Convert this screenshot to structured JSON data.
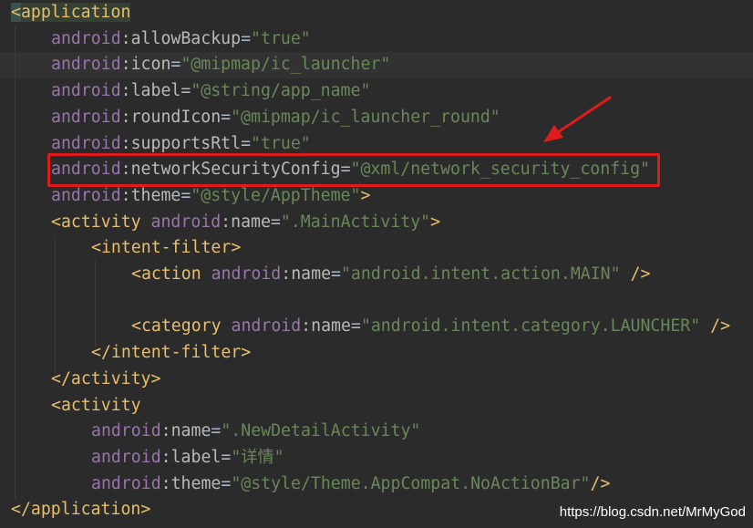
{
  "lines": [
    {
      "segs": [
        [
          "br",
          "<"
        ],
        [
          "tag",
          "application"
        ]
      ]
    },
    {
      "segs": [
        [
          "ns",
          "android"
        ],
        [
          "at",
          ":allowBackup"
        ],
        [
          "pn",
          "="
        ],
        [
          "st",
          "\"true\""
        ]
      ]
    },
    {
      "segs": [
        [
          "ns",
          "android"
        ],
        [
          "at",
          ":icon"
        ],
        [
          "pn",
          "="
        ],
        [
          "st",
          "\"@mipmap/ic_launcher\""
        ]
      ]
    },
    {
      "segs": [
        [
          "ns",
          "android"
        ],
        [
          "at",
          ":label"
        ],
        [
          "pn",
          "="
        ],
        [
          "st",
          "\"@string/app_name\""
        ]
      ]
    },
    {
      "segs": [
        [
          "ns",
          "android"
        ],
        [
          "at",
          ":roundIcon"
        ],
        [
          "pn",
          "="
        ],
        [
          "st",
          "\"@mipmap/ic_launcher_round\""
        ]
      ]
    },
    {
      "segs": [
        [
          "ns",
          "android"
        ],
        [
          "at",
          ":supportsRtl"
        ],
        [
          "pn",
          "="
        ],
        [
          "st",
          "\"true\""
        ]
      ]
    },
    {
      "segs": [
        [
          "ns",
          "android"
        ],
        [
          "at",
          ":networkSecurityConfig"
        ],
        [
          "pn",
          "="
        ],
        [
          "st",
          "\"@xml/network_security_config\""
        ]
      ]
    },
    {
      "segs": [
        [
          "ns",
          "android"
        ],
        [
          "at",
          ":theme"
        ],
        [
          "pn",
          "="
        ],
        [
          "st",
          "\"@style/AppTheme\""
        ],
        [
          "br",
          ">"
        ]
      ]
    },
    {
      "segs": [
        [
          "br",
          "<"
        ],
        [
          "tag",
          "activity "
        ],
        [
          "ns",
          "android"
        ],
        [
          "at",
          ":name"
        ],
        [
          "pn",
          "="
        ],
        [
          "st",
          "\".MainActivity\""
        ],
        [
          "br",
          ">"
        ]
      ]
    },
    {
      "segs": [
        [
          "br",
          "<"
        ],
        [
          "tag",
          "intent-filter"
        ],
        [
          "br",
          ">"
        ]
      ]
    },
    {
      "segs": [
        [
          "br",
          "<"
        ],
        [
          "tag",
          "action "
        ],
        [
          "ns",
          "android"
        ],
        [
          "at",
          ":name"
        ],
        [
          "pn",
          "="
        ],
        [
          "st",
          "\"android.intent.action.MAIN\""
        ],
        [
          "br",
          " />"
        ]
      ]
    },
    {
      "segs": []
    },
    {
      "segs": [
        [
          "br",
          "<"
        ],
        [
          "tag",
          "category "
        ],
        [
          "ns",
          "android"
        ],
        [
          "at",
          ":name"
        ],
        [
          "pn",
          "="
        ],
        [
          "st",
          "\"android.intent.category.LAUNCHER\""
        ],
        [
          "br",
          " />"
        ]
      ]
    },
    {
      "segs": [
        [
          "br",
          "</"
        ],
        [
          "tag",
          "intent-filter"
        ],
        [
          "br",
          ">"
        ]
      ]
    },
    {
      "segs": [
        [
          "br",
          "</"
        ],
        [
          "tag",
          "activity"
        ],
        [
          "br",
          ">"
        ]
      ]
    },
    {
      "segs": [
        [
          "br",
          "<"
        ],
        [
          "tag",
          "activity"
        ]
      ]
    },
    {
      "segs": [
        [
          "ns",
          "android"
        ],
        [
          "at",
          ":name"
        ],
        [
          "pn",
          "="
        ],
        [
          "st",
          "\".NewDetailActivity\""
        ]
      ]
    },
    {
      "segs": [
        [
          "ns",
          "android"
        ],
        [
          "at",
          ":label"
        ],
        [
          "pn",
          "="
        ],
        [
          "st",
          "\"详情\""
        ]
      ]
    },
    {
      "segs": [
        [
          "ns",
          "android"
        ],
        [
          "at",
          ":theme"
        ],
        [
          "pn",
          "="
        ],
        [
          "st",
          "\"@style/Theme.AppCompat.NoActionBar\""
        ],
        [
          "br",
          "/>"
        ]
      ]
    },
    {
      "segs": [
        [
          "br",
          "</"
        ],
        [
          "tag",
          "application"
        ],
        [
          "br",
          ">"
        ]
      ]
    }
  ],
  "highlighted_attribute": "networkSecurityConfig",
  "watermark": "https://blog.csdn.net/MrMyGod",
  "colors": {
    "background": "#2b2b2b",
    "tag": "#e8bf6a",
    "namespace": "#9876aa",
    "attribute": "#bababa",
    "string": "#6a8759",
    "annotation_red": "#e01b1b"
  }
}
